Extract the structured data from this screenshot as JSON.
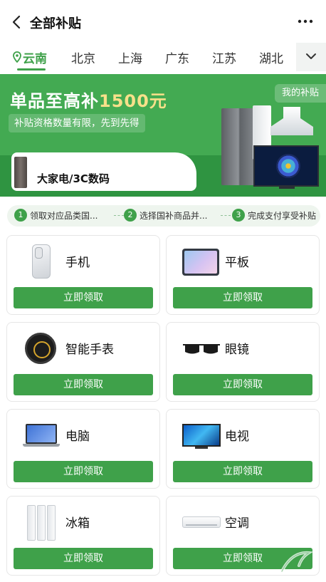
{
  "header": {
    "title": "全部补贴",
    "back_icon": "chevron-left-icon",
    "more_icon": "more-dots-icon"
  },
  "region_tabs": {
    "items": [
      {
        "label": "云南",
        "active": true
      },
      {
        "label": "北京",
        "active": false
      },
      {
        "label": "上海",
        "active": false
      },
      {
        "label": "广东",
        "active": false
      },
      {
        "label": "江苏",
        "active": false
      },
      {
        "label": "湖北",
        "active": false
      }
    ],
    "location_icon": "location-pin-icon",
    "expand_icon": "chevron-down-icon"
  },
  "banner": {
    "title_prefix": "单品至高补",
    "title_amount": "1500元",
    "subtitle": "补贴资格数量有限，先到先得",
    "my_subsidy_label": "我的补贴",
    "category_label": "大家电/3C数码"
  },
  "steps": [
    {
      "num": "1",
      "text": "领取对应品类国..."
    },
    {
      "num": "2",
      "text": "选择国补商品并..."
    },
    {
      "num": "3",
      "text": "完成支付享受补贴"
    }
  ],
  "categories": [
    {
      "name": "手机",
      "button": "立即领取",
      "icon": "phone-icon"
    },
    {
      "name": "平板",
      "button": "立即领取",
      "icon": "tablet-icon"
    },
    {
      "name": "智能手表",
      "button": "立即领取",
      "icon": "smartwatch-icon"
    },
    {
      "name": "眼镜",
      "button": "立即领取",
      "icon": "glasses-icon"
    },
    {
      "name": "电脑",
      "button": "立即领取",
      "icon": "laptop-icon"
    },
    {
      "name": "电视",
      "button": "立即领取",
      "icon": "tv-icon"
    },
    {
      "name": "冰箱",
      "button": "立即领取",
      "icon": "fridge-icon"
    },
    {
      "name": "空调",
      "button": "立即领取",
      "icon": "air-conditioner-icon"
    }
  ],
  "colors": {
    "accent": "#3fa14a",
    "banner": "#43aa52",
    "highlight": "#f7e08a"
  }
}
